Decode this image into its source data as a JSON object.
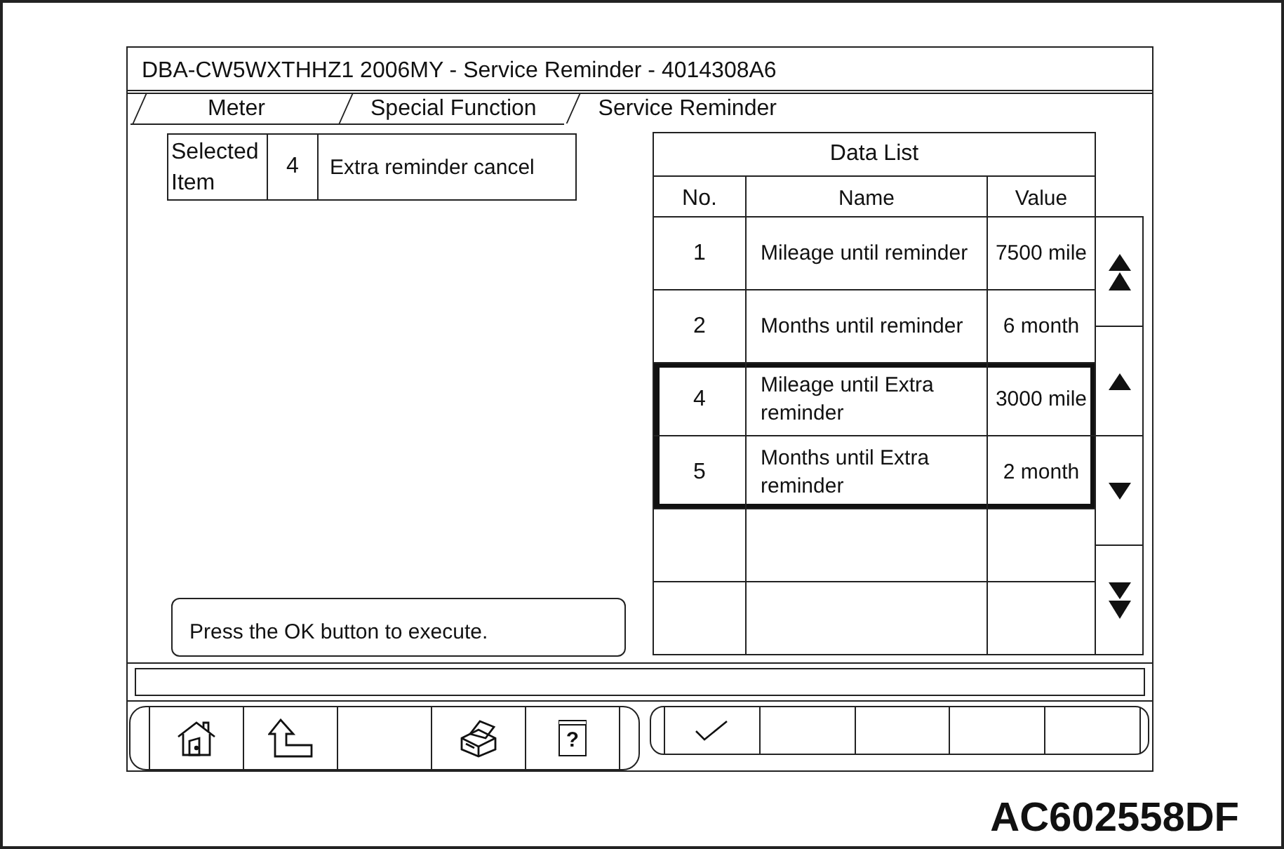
{
  "window": {
    "title": "DBA-CW5WXTHHZ1 2006MY - Service Reminder - 4014308A6"
  },
  "tabs": [
    {
      "label": "Meter",
      "selected": false
    },
    {
      "label": "Special Function",
      "selected": false
    },
    {
      "label": "Service Reminder",
      "selected": true
    }
  ],
  "selected_item": {
    "label": "Selected Item",
    "number": "4",
    "name": "Extra reminder cancel"
  },
  "data_list": {
    "title": "Data List",
    "columns": [
      "No.",
      "Name",
      "Value"
    ],
    "rows": [
      {
        "no": "1",
        "name": "Mileage until reminder",
        "value": "7500 mile",
        "selected": false
      },
      {
        "no": "2",
        "name": "Months until reminder",
        "value": "6 month",
        "selected": false
      },
      {
        "no": "4",
        "name": "Mileage until Extra reminder",
        "value": "3000 mile",
        "selected": true
      },
      {
        "no": "5",
        "name": "Months until Extra reminder",
        "value": "2 month",
        "selected": true
      }
    ]
  },
  "message": "Press the OK button to execute.",
  "toolbar": {
    "left": [
      {
        "kind": "home"
      },
      {
        "kind": "return"
      },
      {
        "kind": "blank"
      },
      {
        "kind": "print"
      },
      {
        "kind": "help",
        "glyph": "?"
      }
    ],
    "right": [
      {
        "kind": "check"
      },
      {
        "kind": "blank"
      },
      {
        "kind": "blank"
      },
      {
        "kind": "blank"
      },
      {
        "kind": "blank"
      }
    ]
  },
  "figure_code": "AC602558DF"
}
